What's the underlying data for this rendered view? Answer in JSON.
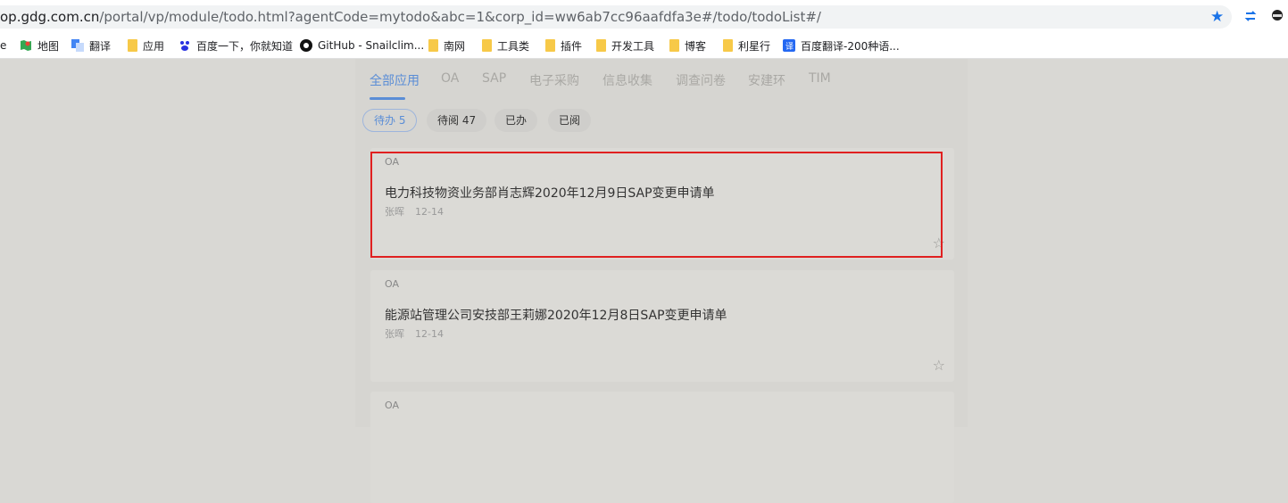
{
  "browser": {
    "url_host": "op.gdg.com.cn",
    "url_path": "/portal/vp/module/todo.html?agentCode=mytodo&abc=1&corp_id=ww6ab7cc96aafdfa3e#/todo/todoList#/"
  },
  "bookmarks": [
    {
      "label": "e",
      "icon": "truncated"
    },
    {
      "label": "地图",
      "icon": "maps-icon"
    },
    {
      "label": "翻译",
      "icon": "translate-icon"
    },
    {
      "label": "应用",
      "icon": "folder-icon"
    },
    {
      "label": "百度一下，你就知道",
      "icon": "baidu-icon"
    },
    {
      "label": "GitHub - Snailclim...",
      "icon": "github-icon"
    },
    {
      "label": "南网",
      "icon": "folder-icon"
    },
    {
      "label": "工具类",
      "icon": "folder-icon"
    },
    {
      "label": "插件",
      "icon": "folder-icon"
    },
    {
      "label": "开发工具",
      "icon": "folder-icon"
    },
    {
      "label": "博客",
      "icon": "folder-icon"
    },
    {
      "label": "利星行",
      "icon": "folder-icon"
    },
    {
      "label": "百度翻译-200种语...",
      "icon": "baidu-translate-icon"
    }
  ],
  "tabs": [
    "全部应用",
    "OA",
    "SAP",
    "电子采购",
    "信息收集",
    "调查问卷",
    "安建环",
    "TIM"
  ],
  "filters": [
    "待办 5",
    "待阅 47",
    "已办",
    "已阅"
  ],
  "cards": [
    {
      "category": "OA",
      "title": "电力科技物资业务部肖志辉2020年12月9日SAP变更申请单",
      "author": "张晖",
      "date": "12-14"
    },
    {
      "category": "OA",
      "title": "能源站管理公司安技部王莉娜2020年12月8日SAP变更申请单",
      "author": "张晖",
      "date": "12-14"
    },
    {
      "category": "OA",
      "title": "",
      "author": "",
      "date": ""
    }
  ],
  "colors": {
    "accent": "#5a8dd6",
    "highlight": "#e02020"
  }
}
